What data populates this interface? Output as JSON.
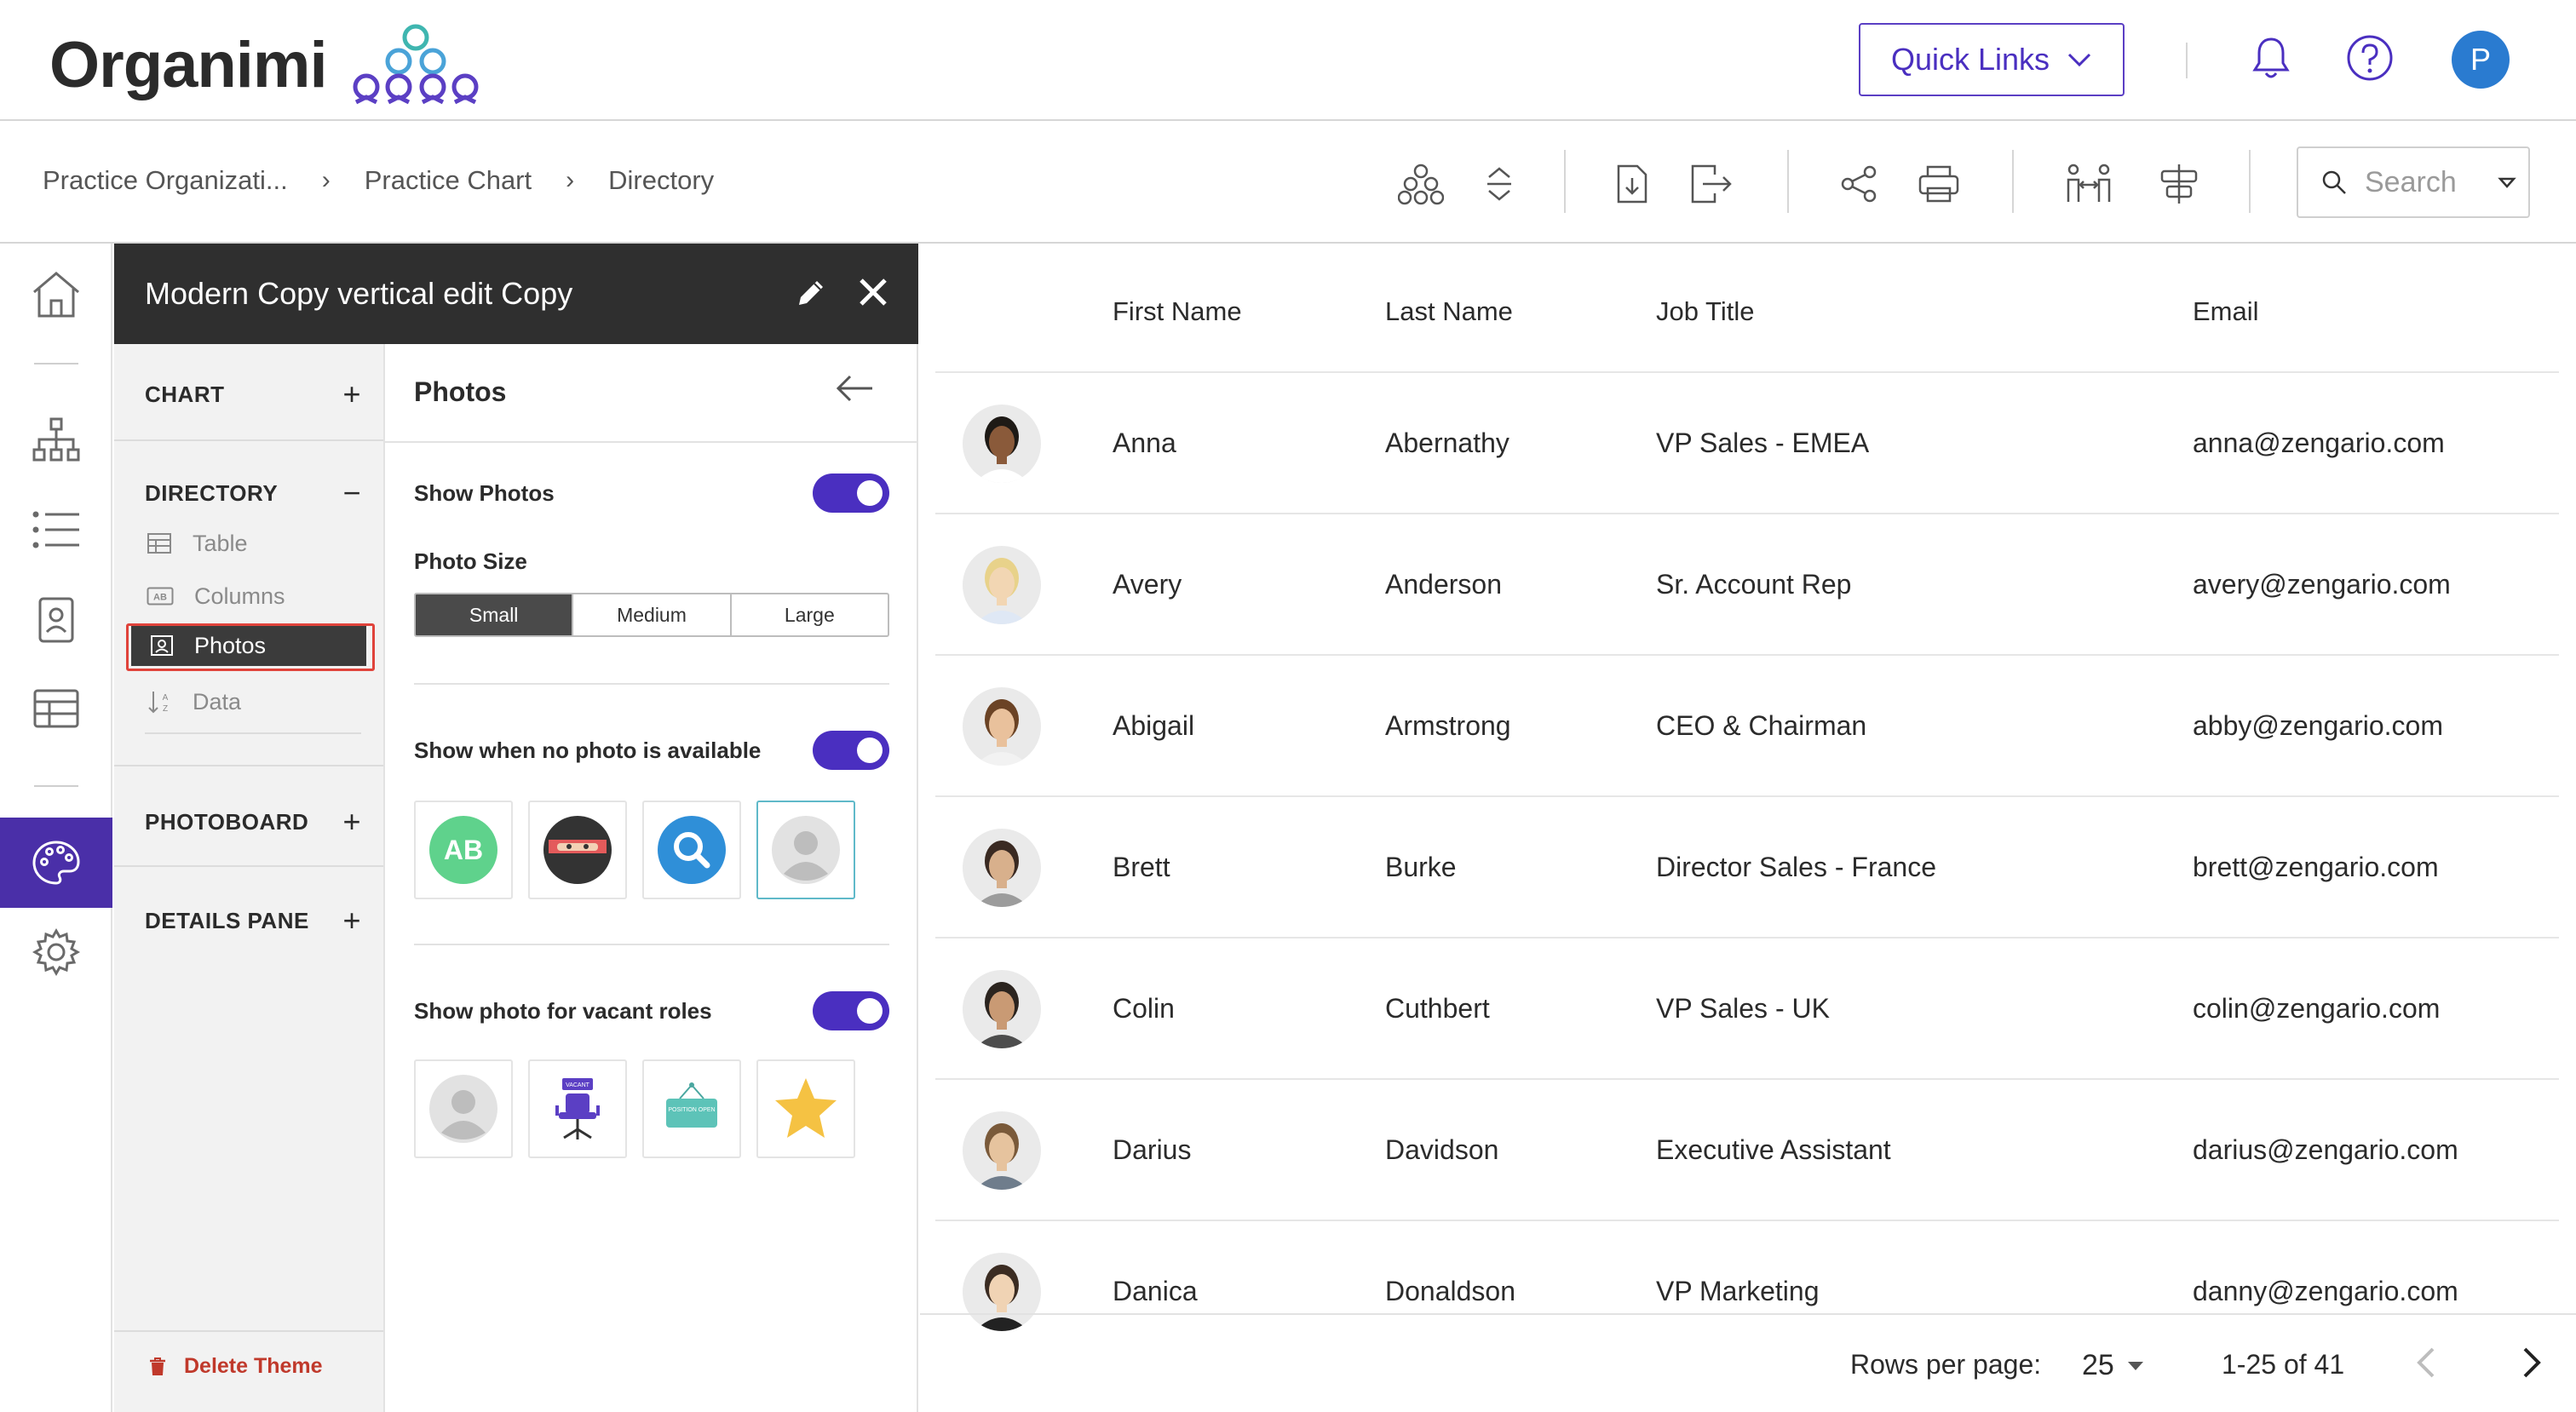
{
  "brand": {
    "name": "Organimi",
    "accent": "#4a2fc0"
  },
  "header": {
    "quick_links_label": "Quick Links",
    "avatar_initial": "P"
  },
  "breadcrumb": [
    "Practice Organizati...",
    "Practice Chart",
    "Directory"
  ],
  "search": {
    "placeholder": "Search"
  },
  "theme_panel": {
    "title": "Modern Copy vertical edit Copy",
    "sections": {
      "chart": "CHART",
      "directory": "DIRECTORY",
      "photoboard": "PHOTOBOARD",
      "details_pane": "DETAILS PANE"
    },
    "directory_items": [
      "Table",
      "Columns",
      "Photos",
      "Data"
    ],
    "delete_label": "Delete Theme"
  },
  "photos_settings": {
    "title": "Photos",
    "show_photos_label": "Show Photos",
    "show_photos": true,
    "photo_size_label": "Photo Size",
    "sizes": [
      "Small",
      "Medium",
      "Large"
    ],
    "selected_size": "Small",
    "no_photo_label": "Show when no photo is available",
    "no_photo": true,
    "no_photo_initials": "AB",
    "vacant_label": "Show photo for vacant roles",
    "vacant": true,
    "vacant_badge": "VACANT",
    "position_open_text": "POSITION OPEN"
  },
  "table": {
    "columns": [
      "First Name",
      "Last Name",
      "Job Title",
      "Email"
    ],
    "rows": [
      {
        "first": "Anna",
        "last": "Abernathy",
        "title": "VP Sales - EMEA",
        "email": "anna@zengario.com"
      },
      {
        "first": "Avery",
        "last": "Anderson",
        "title": "Sr. Account Rep",
        "email": "avery@zengario.com"
      },
      {
        "first": "Abigail",
        "last": "Armstrong",
        "title": "CEO & Chairman",
        "email": "abby@zengario.com"
      },
      {
        "first": "Brett",
        "last": "Burke",
        "title": "Director Sales - France",
        "email": "brett@zengario.com"
      },
      {
        "first": "Colin",
        "last": "Cuthbert",
        "title": "VP Sales - UK",
        "email": "colin@zengario.com"
      },
      {
        "first": "Darius",
        "last": "Davidson",
        "title": "Executive Assistant",
        "email": "darius@zengario.com"
      },
      {
        "first": "Danica",
        "last": "Donaldson",
        "title": "VP Marketing",
        "email": "danny@zengario.com"
      }
    ],
    "rows_per_page_label": "Rows per page:",
    "rows_per_page": "25",
    "range": "1-25 of 41"
  }
}
